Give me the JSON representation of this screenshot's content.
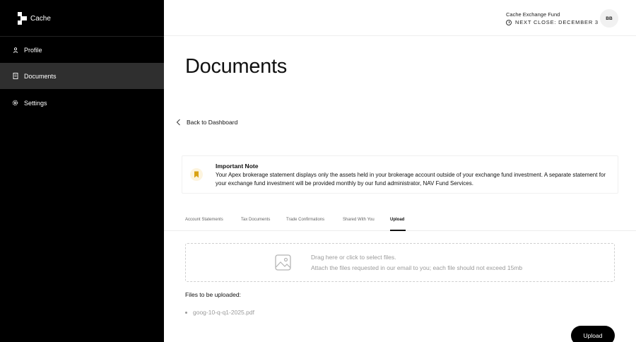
{
  "sidebar": {
    "brand": "Cache",
    "items": [
      {
        "label": "Profile",
        "icon": "person-icon",
        "active": false
      },
      {
        "label": "Documents",
        "icon": "document-icon",
        "active": true
      },
      {
        "label": "Settings",
        "icon": "gear-icon",
        "active": false
      }
    ]
  },
  "header": {
    "fund_name": "Cache Exchange Fund",
    "next_close": "NEXT CLOSE: DECEMBER 3",
    "avatar_initials": "BB"
  },
  "main": {
    "title": "Documents",
    "back_label": "Back to Dashboard",
    "note": {
      "title": "Important Note",
      "body": "Your Apex brokerage statement displays only the assets held in your brokerage account outside of your exchange fund investment. A separate statement for your exchange fund investment will be provided monthly by our fund administrator, NAV Fund Services."
    },
    "tabs": [
      {
        "label": "Account Statements",
        "active": false
      },
      {
        "label": "Tax Documents",
        "active": false
      },
      {
        "label": "Trade Confirmations",
        "active": false
      },
      {
        "label": "Shared With You",
        "active": false
      },
      {
        "label": "Upload",
        "active": true
      }
    ],
    "dropzone": {
      "line1": "Drag here or click to select files.",
      "line2": "Attach the files requested in our email to you; each file should not exceed 15mb"
    },
    "files_heading": "Files to be uploaded:",
    "files": [
      "goog-10-q-q1-2025.pdf"
    ],
    "upload_label": "Upload"
  },
  "colors": {
    "sidebar_bg": "#000000",
    "active_nav_bg": "#2f2f2f",
    "note_icon_bg": "#fdf4de",
    "note_icon_color": "#d9a214",
    "muted_text": "#9a9a9a"
  }
}
